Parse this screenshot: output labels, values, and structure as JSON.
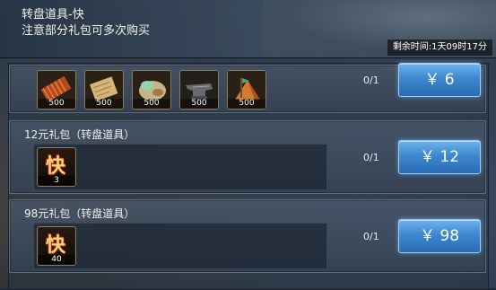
{
  "header": {
    "title": "转盘道具-快",
    "subtitle": "注意部分礼包可多次购买",
    "timer": "剩余时间:1天09时17分"
  },
  "packs": [
    {
      "title": "",
      "items": [
        {
          "icon": "bamboo-slips-icon",
          "qty": "500"
        },
        {
          "icon": "scroll-icon",
          "qty": "500"
        },
        {
          "icon": "treasure-sack-icon",
          "qty": "500"
        },
        {
          "icon": "anvil-icon",
          "qty": "500"
        },
        {
          "icon": "banner-tent-icon",
          "qty": "500"
        }
      ],
      "progress": "0/1",
      "price": "￥ 6"
    },
    {
      "title": "12元礼包（转盘道具）",
      "items": [
        {
          "icon": "kuai-token-icon",
          "glyph": "快",
          "qty": "3"
        }
      ],
      "progress": "0/1",
      "price": "￥ 12"
    },
    {
      "title": "98元礼包（转盘道具）",
      "items": [
        {
          "icon": "kuai-token-icon",
          "glyph": "快",
          "qty": "40"
        }
      ],
      "progress": "0/1",
      "price": "￥ 98"
    }
  ],
  "colors": {
    "button": "#3d88cf",
    "frame": "#8a7a56",
    "kuai": "#ffd27a"
  }
}
